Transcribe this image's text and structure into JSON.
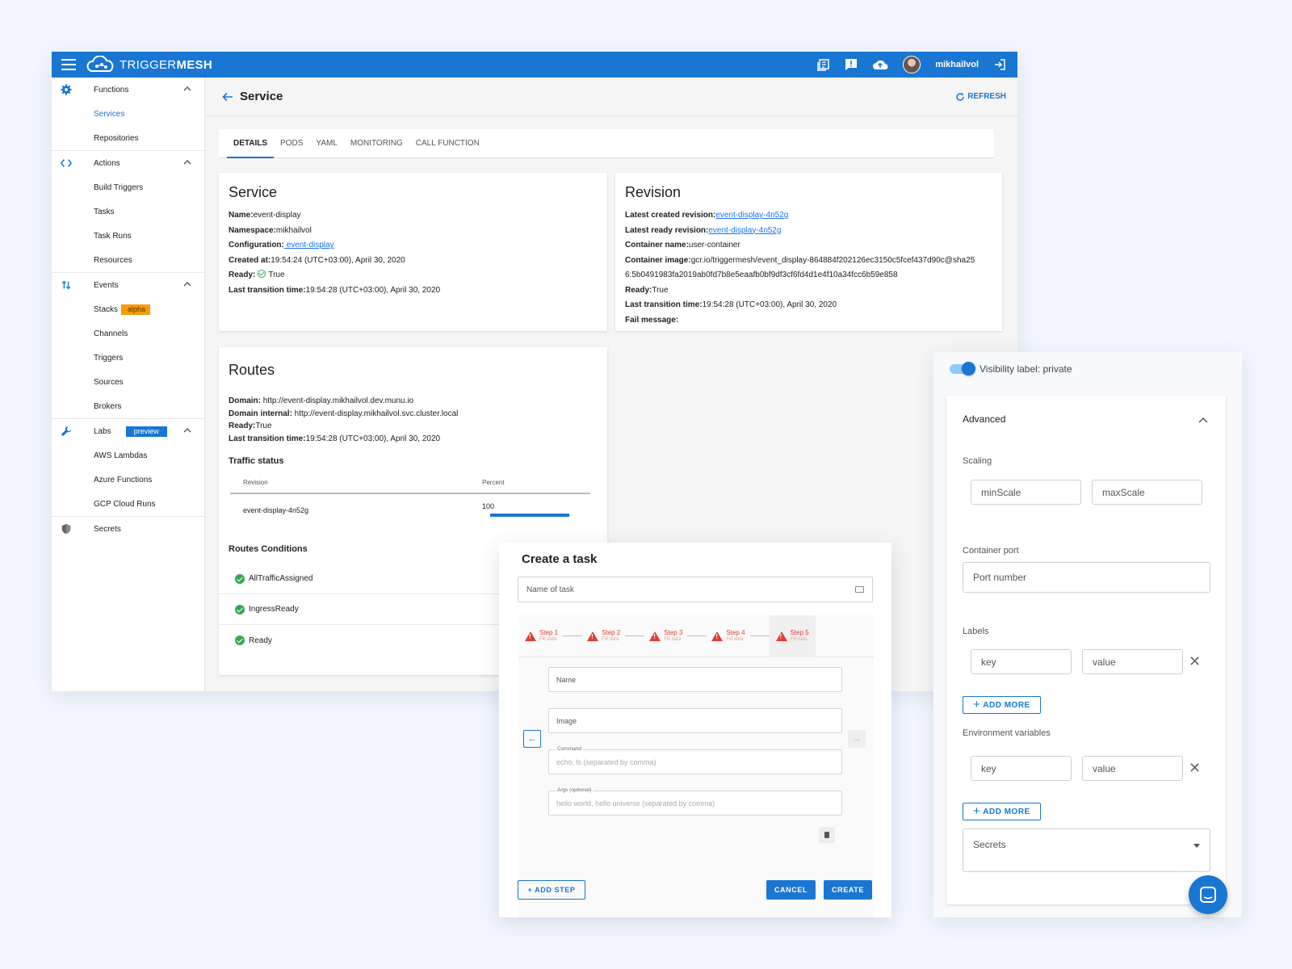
{
  "header": {
    "brand_light": "TRIGGER",
    "brand_bold": "MESH",
    "username": "mikhailvol",
    "icons": [
      "docs-icon",
      "feedback-icon",
      "cloud-upload-icon",
      "avatar",
      "logout-icon"
    ]
  },
  "sidebar": {
    "groups": [
      {
        "label": "Functions",
        "icon": "gear-icon",
        "items": [
          "Services",
          "Repositories"
        ]
      },
      {
        "label": "Actions",
        "icon": "code-icon",
        "items": [
          "Build Triggers",
          "Tasks",
          "Task Runs",
          "Resources"
        ]
      },
      {
        "label": "Events",
        "icon": "swap-vert-icon",
        "items": [
          "Stacks",
          "Channels",
          "Triggers",
          "Sources",
          "Brokers"
        ]
      },
      {
        "label": "Labs",
        "icon": "wrench-icon",
        "items": [
          "AWS Lambdas",
          "Azure Functions",
          "GCP Cloud Runs"
        ]
      },
      {
        "label": "Secrets",
        "icon": "shield-icon"
      }
    ],
    "stacks_badge": "alpha",
    "labs_badge": "preview"
  },
  "page": {
    "title": "Service",
    "refresh_label": "REFRESH",
    "tabs": [
      "DETAILS",
      "PODS",
      "YAML",
      "MONITORING",
      "CALL FUNCTION"
    ]
  },
  "service": {
    "title": "Service",
    "name_k": "Name:",
    "name_v": "event-display",
    "namespace_k": "Namespace:",
    "namespace_v": "mikhailvol",
    "config_k": "Configuration:",
    "config_v": " event-display",
    "created_k": "Created at:",
    "created_v": "19:54:24 (UTC+03:00), April 30, 2020",
    "ready_k": "Ready:",
    "ready_v": "True",
    "transition_k": "Last transition time:",
    "transition_v": "19:54:28 (UTC+03:00), April 30, 2020"
  },
  "revision": {
    "title": "Revision",
    "latest_created_k": "Latest created revision:",
    "latest_created_v": "event-display-4n52g",
    "latest_ready_k": "Latest ready revision:",
    "latest_ready_v": "event-display-4n52g",
    "container_name_k": "Container name:",
    "container_name_v": "user-container",
    "container_image_k": "Container image:",
    "container_image_v": "gcr.io/triggermesh/event_display-864884f202126ec3150c5fcef437d90c@sha25",
    "container_image_v2": "6:5b0491983fa2019ab0fd7b8e5eaafb0bf9df3cf6fd4d1e4f10a34fcc6b59e858",
    "ready_k": "Ready:",
    "ready_v": "True",
    "transition_k": "Last transition time:",
    "transition_v": "19:54:28 (UTC+03:00), April 30, 2020",
    "fail_k": "Fail message:"
  },
  "routes": {
    "title": "Routes",
    "domain_k": "Domain:",
    "domain_v": " http://event-display.mikhailvol.dev.munu.io",
    "internal_k": "Domain internal:",
    "internal_v": " http://event-display.mikhailvol.svc.cluster.local",
    "ready_k": "Ready:",
    "ready_v": "True",
    "transition_k": "Last transition time:",
    "transition_v": "19:54:28 (UTC+03:00), April 30, 2020",
    "traffic_title": "Traffic status",
    "col_revision": "Revision",
    "col_percent": "Percent",
    "row_revision": "event-display-4n52g",
    "row_percent": "100",
    "traffic_fraction": 1.0,
    "conditions_title": "Routes Conditions",
    "conditions": [
      "AllTrafficAssigned",
      "IngressReady",
      "Ready"
    ]
  },
  "advanced": {
    "visibility": "Visibility label: private",
    "visibility_on": true,
    "title": "Advanced",
    "scaling_label": "Scaling",
    "min_scale": "minScale",
    "max_scale": "maxScale",
    "port_label": "Container port",
    "port_placeholder": "Port number",
    "labels_label": "Labels",
    "key": "key",
    "value": "value",
    "add_more": "ADD MORE",
    "env_label": "Environment variables",
    "secrets": "Secrets"
  },
  "task": {
    "title": "Create a task",
    "name_placeholder": "Name of task",
    "steps": [
      {
        "label": "Step 1",
        "sub": "Fill data"
      },
      {
        "label": "Step 2",
        "sub": "Fill data"
      },
      {
        "label": "Step 3",
        "sub": "Fill data"
      },
      {
        "label": "Step 4",
        "sub": "Fill data"
      },
      {
        "label": "Step 5",
        "sub": "Fill data"
      }
    ],
    "name_field": "Name",
    "image_field": "Image",
    "command_label": "Command",
    "command_placeholder": "echo, ls (separated by comma)",
    "args_label": "Args (optional)",
    "args_placeholder": "hello world, hello universe (separated by comma)",
    "add_step": "+ ADD STEP",
    "cancel": "CANCEL",
    "create": "CREATE"
  },
  "colors": {
    "primary": "#1976d2",
    "success": "#34a853",
    "error": "#e53935",
    "alpha_badge": "#f59c0b"
  }
}
